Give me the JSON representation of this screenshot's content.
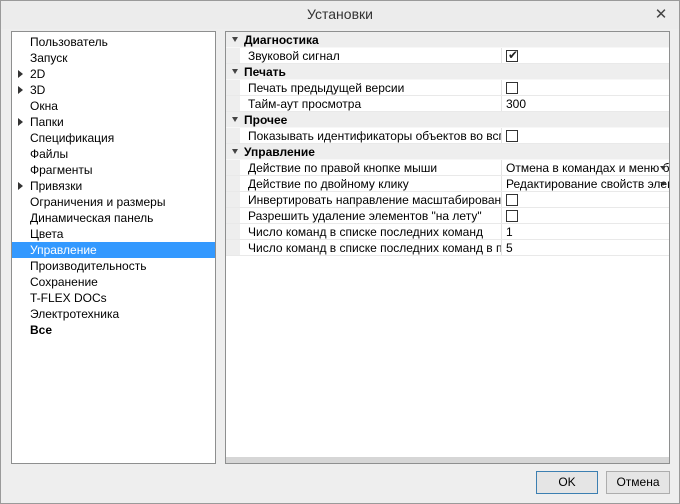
{
  "window": {
    "title": "Установки",
    "close_label": "✕"
  },
  "sidebar": {
    "items": [
      {
        "label": "Пользователь",
        "expandable": false,
        "selected": false,
        "bold": false
      },
      {
        "label": "Запуск",
        "expandable": false,
        "selected": false,
        "bold": false
      },
      {
        "label": "2D",
        "expandable": true,
        "selected": false,
        "bold": false
      },
      {
        "label": "3D",
        "expandable": true,
        "selected": false,
        "bold": false
      },
      {
        "label": "Окна",
        "expandable": false,
        "selected": false,
        "bold": false
      },
      {
        "label": "Папки",
        "expandable": true,
        "selected": false,
        "bold": false
      },
      {
        "label": "Спецификация",
        "expandable": false,
        "selected": false,
        "bold": false
      },
      {
        "label": "Файлы",
        "expandable": false,
        "selected": false,
        "bold": false
      },
      {
        "label": "Фрагменты",
        "expandable": false,
        "selected": false,
        "bold": false
      },
      {
        "label": "Привязки",
        "expandable": true,
        "selected": false,
        "bold": false
      },
      {
        "label": "Ограничения и размеры",
        "expandable": false,
        "selected": false,
        "bold": false
      },
      {
        "label": "Динамическая панель",
        "expandable": false,
        "selected": false,
        "bold": false
      },
      {
        "label": "Цвета",
        "expandable": false,
        "selected": false,
        "bold": false
      },
      {
        "label": "Управление",
        "expandable": false,
        "selected": true,
        "bold": false
      },
      {
        "label": "Производительность",
        "expandable": false,
        "selected": false,
        "bold": false
      },
      {
        "label": "Сохранение",
        "expandable": false,
        "selected": false,
        "bold": false
      },
      {
        "label": "T-FLEX DOCs",
        "expandable": false,
        "selected": false,
        "bold": false
      },
      {
        "label": "Электротехника",
        "expandable": false,
        "selected": false,
        "bold": false
      },
      {
        "label": "Все",
        "expandable": false,
        "selected": false,
        "bold": true
      }
    ]
  },
  "grid": {
    "sections": [
      {
        "title": "Диагностика",
        "rows": [
          {
            "name": "Звуковой сигнал",
            "type": "checkbox",
            "checked": true
          }
        ]
      },
      {
        "title": "Печать",
        "rows": [
          {
            "name": "Печать предыдущей версии",
            "type": "checkbox",
            "checked": false
          },
          {
            "name": "Тайм-аут просмотра",
            "type": "text",
            "value": "300"
          }
        ]
      },
      {
        "title": "Прочее",
        "rows": [
          {
            "name": "Показывать идентификаторы объектов во всплыва...",
            "type": "checkbox",
            "checked": false
          }
        ]
      },
      {
        "title": "Управление",
        "rows": [
          {
            "name": "Действие по правой кнопке мыши",
            "type": "dropdown",
            "value": "Отмена в командах и меню без к"
          },
          {
            "name": "Действие по двойному клику",
            "type": "dropdown",
            "value": "Редактирование свойств элемен"
          },
          {
            "name": "Инвертировать направление масштабирования пр...",
            "type": "checkbox",
            "checked": false
          },
          {
            "name": "Разрешить удаление элементов \"на лету\"",
            "type": "checkbox",
            "checked": false
          },
          {
            "name": "Число команд в списке последних команд",
            "type": "text",
            "value": "1"
          },
          {
            "name": "Число команд в списке последних команд в подме...",
            "type": "text",
            "value": "5"
          }
        ]
      }
    ]
  },
  "buttons": {
    "ok": "OK",
    "cancel": "Отмена"
  }
}
